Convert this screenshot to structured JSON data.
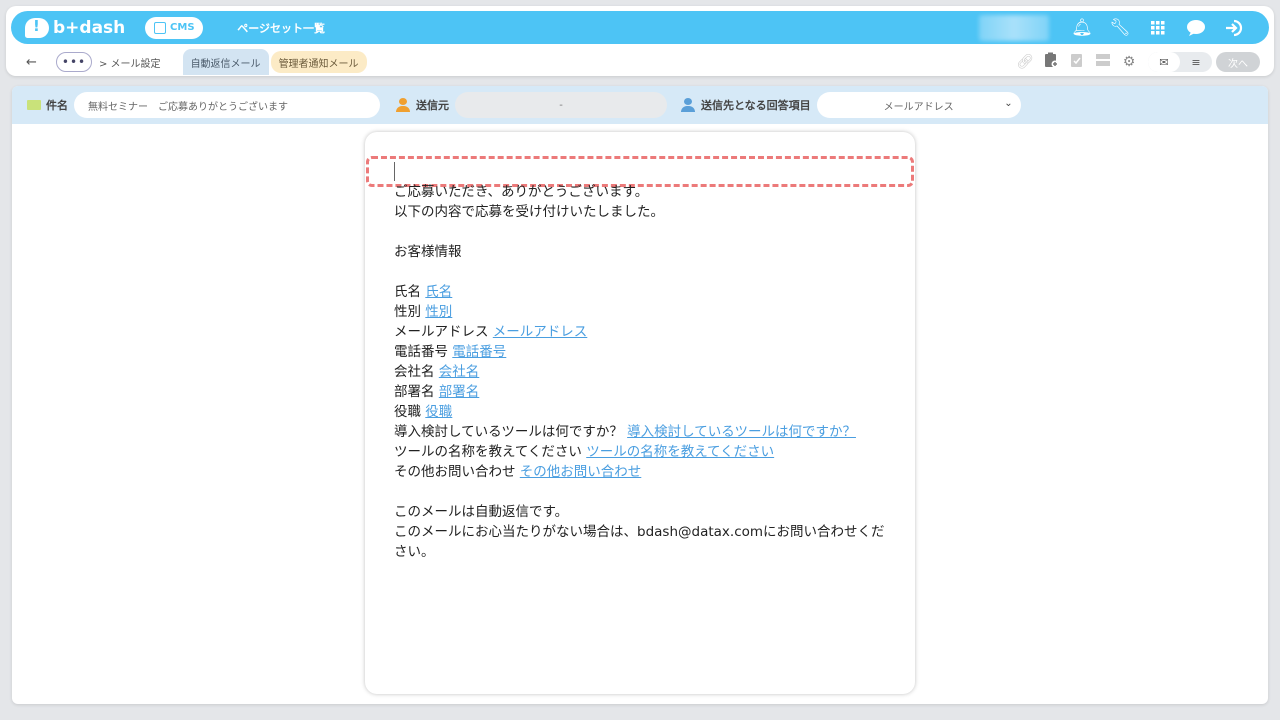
{
  "header": {
    "logo": "b+dash",
    "cms_label": "CMS",
    "title": "ページセット一覧"
  },
  "subnav": {
    "back": "←",
    "dots": "•••",
    "breadcrumb": "> メール設定",
    "tabs": [
      "自動返信メール",
      "管理者通知メール"
    ],
    "next_label": "次へ"
  },
  "settings": {
    "subject_label": "件名",
    "subject_value": "無料セミナー　ご応募ありがとうございます",
    "sender_label": "送信元",
    "sender_value": "-",
    "recipient_label": "送信先となる回答項目",
    "recipient_value": "メールアドレス"
  },
  "email": {
    "line1": "ご応募いただき、ありがとうございます。",
    "line2": "以下の内容で応募を受け付けいたしました。",
    "section_title": "お客様情報",
    "fields": [
      {
        "label": "氏名",
        "link": "氏名"
      },
      {
        "label": "性別",
        "link": "性別"
      },
      {
        "label": "メールアドレス",
        "link": "メールアドレス"
      },
      {
        "label": "電話番号",
        "link": "電話番号"
      },
      {
        "label": "会社名",
        "link": "会社名"
      },
      {
        "label": "部署名",
        "link": "部署名"
      },
      {
        "label": "役職",
        "link": "役職"
      },
      {
        "label": "導入検討しているツールは何ですか？",
        "link": "導入検討しているツールは何ですか？"
      },
      {
        "label": "ツールの名称を教えてください",
        "link": "ツールの名称を教えてください"
      },
      {
        "label": "その他お問い合わせ",
        "link": "その他お問い合わせ"
      }
    ],
    "footer1": "このメールは自動返信です。",
    "footer2": "このメールにお心当たりがない場合は、bdash@datax.comにお問い合わせくだ",
    "footer3": "さい。"
  },
  "colors": {
    "brand": "#4dc4f5",
    "highlight": "#ec7a7a",
    "link": "#4a9ee0"
  }
}
